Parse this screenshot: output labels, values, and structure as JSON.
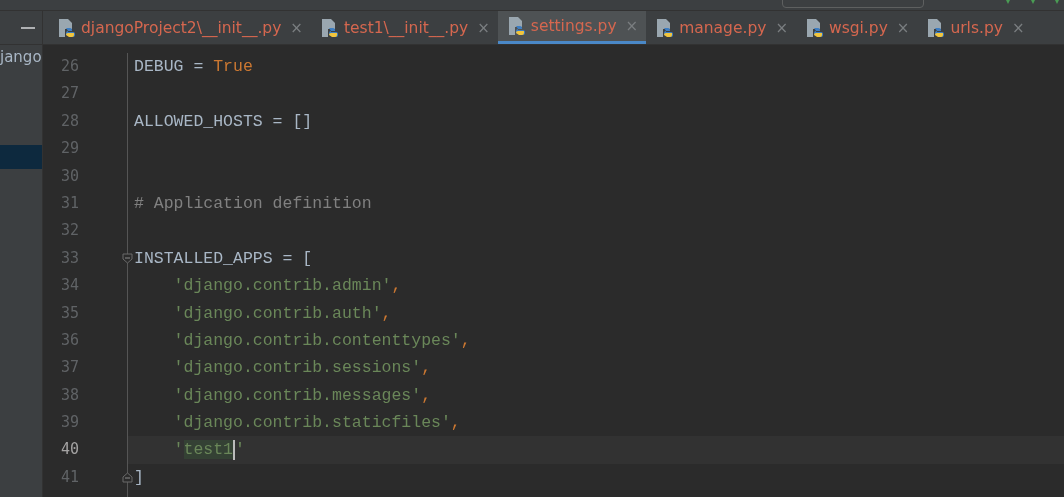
{
  "project_panel": {
    "items": [
      {
        "label": "jango",
        "selected": false
      },
      {
        "selected": true
      }
    ]
  },
  "tabs": [
    {
      "label": "djangoProject2\\__init__.py",
      "close": "×",
      "selected": false
    },
    {
      "label": "test1\\__init__.py",
      "close": "×",
      "selected": false
    },
    {
      "label": "settings.py",
      "close": "×",
      "selected": true
    },
    {
      "label": "manage.py",
      "close": "×",
      "selected": false
    },
    {
      "label": "wsgi.py",
      "close": "×",
      "selected": false
    },
    {
      "label": "urls.py",
      "close": "×",
      "selected": false
    }
  ],
  "editor": {
    "lines": [
      {
        "number": "26",
        "current": false,
        "kind": "plain",
        "tokens": [
          {
            "kind": "ident",
            "text": "DEBUG = "
          },
          {
            "kind": "keyword",
            "text": "True"
          }
        ]
      },
      {
        "number": "27",
        "current": false,
        "kind": "plain"
      },
      {
        "number": "28",
        "current": false,
        "kind": "plain",
        "tokens": [
          {
            "kind": "ident",
            "text": "ALLOWED_HOSTS = "
          },
          {
            "kind": "bracket",
            "text": "[]"
          }
        ]
      },
      {
        "number": "29",
        "current": false,
        "kind": "plain"
      },
      {
        "number": "30",
        "current": false,
        "kind": "plain"
      },
      {
        "number": "31",
        "current": false,
        "kind": "plain",
        "tokens": [
          {
            "kind": "comment",
            "text": "# Application definition"
          }
        ]
      },
      {
        "number": "32",
        "current": false,
        "kind": "plain"
      },
      {
        "number": "33",
        "current": false,
        "kind": "fold_start",
        "tokens": [
          {
            "kind": "ident",
            "text": "INSTALLED_APPS = "
          },
          {
            "kind": "bracket",
            "text": "["
          }
        ]
      },
      {
        "number": "34",
        "current": false,
        "kind": "indented",
        "tokens": [
          {
            "kind": "string",
            "text": "'django.contrib.admin'"
          },
          {
            "kind": "comma",
            "text": ","
          }
        ]
      },
      {
        "number": "35",
        "current": false,
        "kind": "indented",
        "tokens": [
          {
            "kind": "string",
            "text": "'django.contrib.auth'"
          },
          {
            "kind": "comma",
            "text": ","
          }
        ]
      },
      {
        "number": "36",
        "current": false,
        "kind": "indented",
        "tokens": [
          {
            "kind": "string",
            "text": "'django.contrib.contenttypes'"
          },
          {
            "kind": "comma",
            "text": ","
          }
        ]
      },
      {
        "number": "37",
        "current": false,
        "kind": "indented",
        "tokens": [
          {
            "kind": "string",
            "text": "'django.contrib.sessions'"
          },
          {
            "kind": "comma",
            "text": ","
          }
        ]
      },
      {
        "number": "38",
        "current": false,
        "kind": "indented",
        "tokens": [
          {
            "kind": "string",
            "text": "'django.contrib.messages'"
          },
          {
            "kind": "comma",
            "text": ","
          }
        ]
      },
      {
        "number": "39",
        "current": false,
        "kind": "indented",
        "tokens": [
          {
            "kind": "string",
            "text": "'django.contrib.staticfiles'"
          },
          {
            "kind": "comma",
            "text": ","
          }
        ]
      },
      {
        "number": "40",
        "current": true,
        "kind": "indented",
        "tokens": [
          {
            "kind": "string",
            "text": "'"
          },
          {
            "kind": "highlight",
            "text": "test1"
          },
          {
            "kind": "caret"
          },
          {
            "kind": "string",
            "text": "'"
          }
        ]
      },
      {
        "number": "41",
        "current": false,
        "kind": "fold_end",
        "tokens": [
          {
            "kind": "bracket",
            "text": "]"
          }
        ]
      }
    ]
  }
}
